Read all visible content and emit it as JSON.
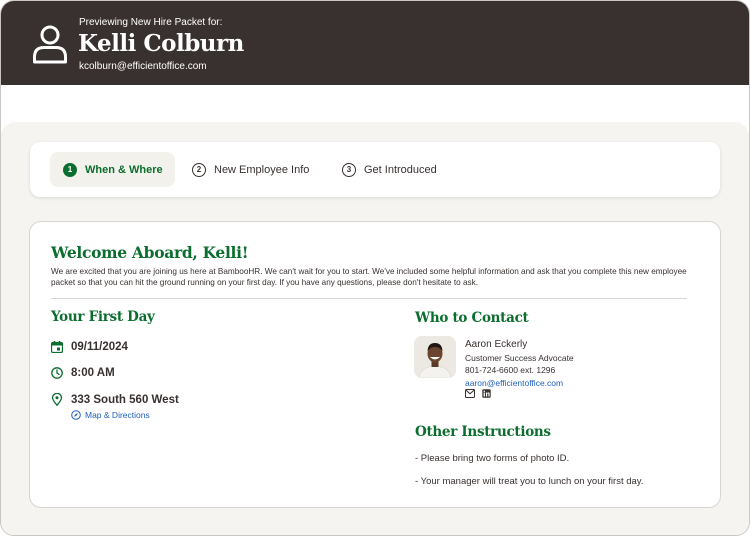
{
  "header": {
    "preview_label": "Previewing New Hire Packet for:",
    "name": "Kelli Colburn",
    "email": "kcolburn@efficientoffice.com",
    "avatar_icon": "user-outline-icon"
  },
  "steps": [
    {
      "number": "1",
      "label": "When & Where",
      "active": true
    },
    {
      "number": "2",
      "label": "New Employee Info",
      "active": false
    },
    {
      "number": "3",
      "label": "Get Introduced",
      "active": false
    }
  ],
  "welcome": {
    "title": "Welcome Aboard, Kelli!",
    "text": "We are excited that you are joining us here at BambooHR. We can't wait for you to start. We've included some helpful information and ask that you complete this new employee packet so that you can hit the ground running on your first day. If you have any questions, please don't hesitate to ask."
  },
  "first_day": {
    "title": "Your First Day",
    "date": "09/11/2024",
    "time": "8:00 AM",
    "address": "333 South 560 West",
    "map_link": "Map & Directions"
  },
  "contact": {
    "title": "Who to Contact",
    "name": "Aaron Eckerly",
    "job_title": "Customer Success Advocate",
    "phone": "801-724-6600 ext. 1296",
    "email": "aaron@efficientoffice.com"
  },
  "instructions": {
    "title": "Other Instructions",
    "items": [
      "- Please bring two forms of photo ID.",
      "- Your manager will treat you to lunch on your first day."
    ]
  },
  "colors": {
    "header_bg": "#38312f",
    "accent_green": "#0b6e2f",
    "link_blue": "#1f5fbf",
    "panel_bg": "#f5f4f1"
  }
}
